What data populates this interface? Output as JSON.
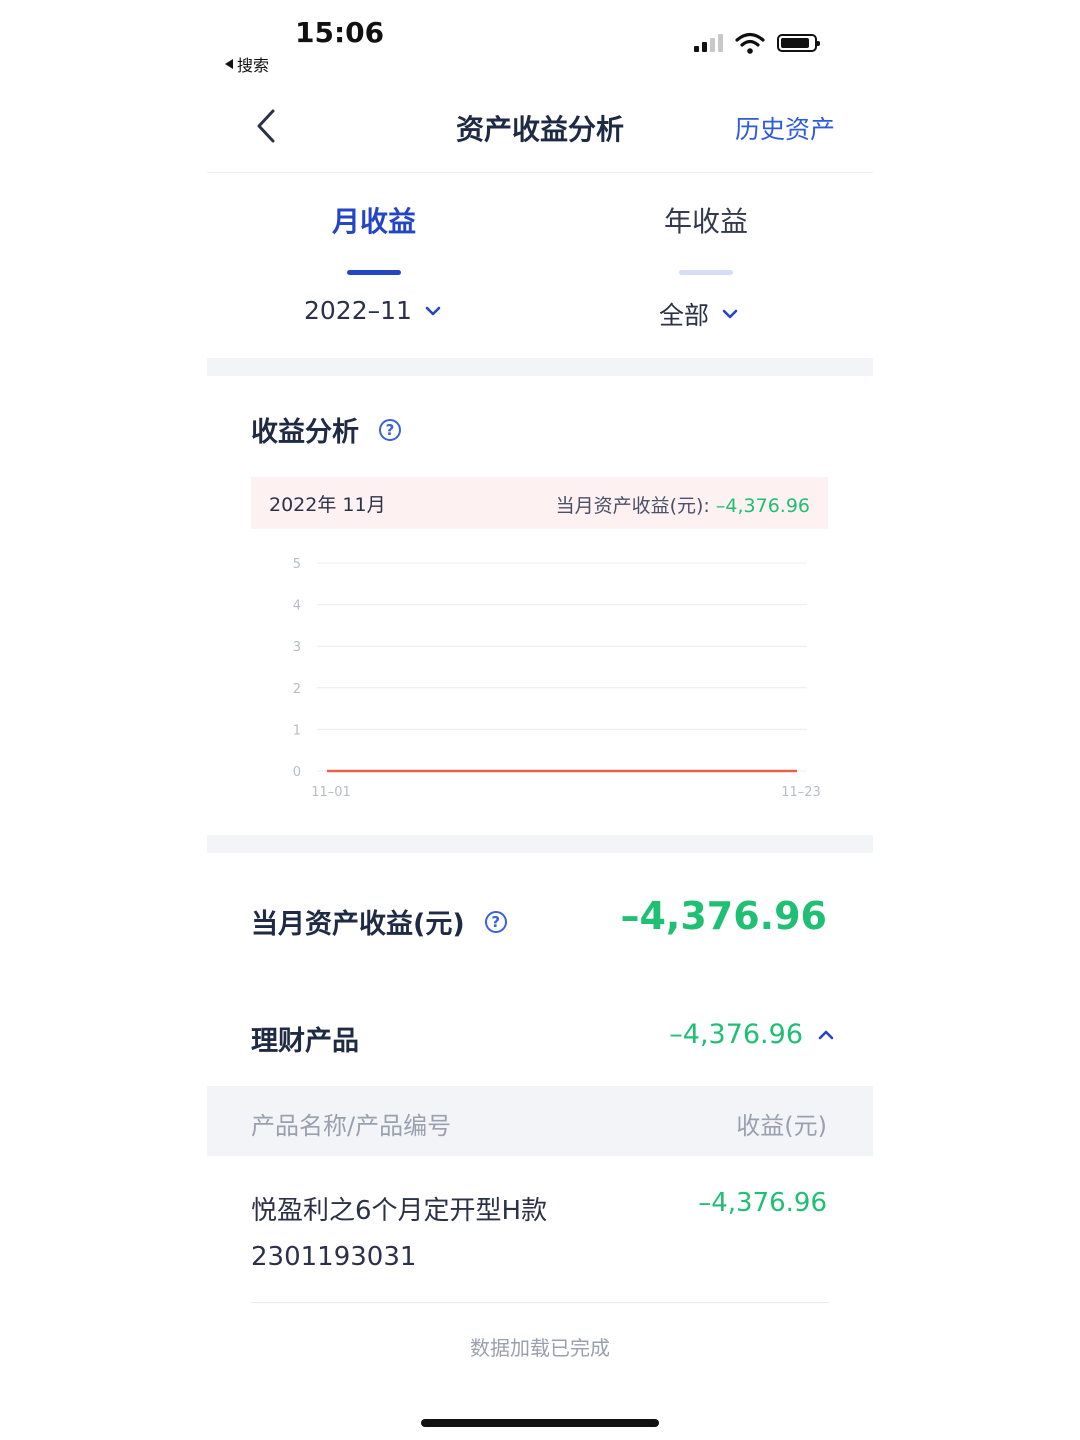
{
  "status_bar": {
    "time": "15:06",
    "back_app": "搜索"
  },
  "nav": {
    "title": "资产收益分析",
    "right_link": "历史资产"
  },
  "tabs": [
    {
      "label": "月收益",
      "active": true
    },
    {
      "label": "年收益",
      "active": false
    }
  ],
  "filters": {
    "date": "2022–11",
    "type": "全部"
  },
  "analysis": {
    "title": "收益分析",
    "period": "2022年 11月",
    "summary_label": "当月资产收益(元):",
    "summary_value": "–4,376.96"
  },
  "chart_data": {
    "type": "line",
    "x": [
      "11–01",
      "11–23"
    ],
    "series": [
      {
        "values": [
          0,
          0
        ]
      }
    ],
    "y_ticks": [
      "5",
      "4",
      "3",
      "2",
      "1",
      "0"
    ],
    "ylim": [
      0,
      5
    ],
    "grid": true,
    "colors": {
      "line": "#e8604c",
      "grid": "#ececf0",
      "tick": "#b8bcc8"
    }
  },
  "month_total": {
    "label": "当月资产收益(元)",
    "value": "–4,376.96"
  },
  "category": {
    "label": "理财产品",
    "value": "–4,376.96"
  },
  "table": {
    "headers": [
      "产品名称/产品编号",
      "收益(元)"
    ],
    "rows": [
      {
        "name": "悦盈利之6个月定开型H款",
        "code": "2301193031",
        "value": "–4,376.96"
      }
    ]
  },
  "footer": {
    "status": "数据加载已完成"
  },
  "colors": {
    "accent": "#2446c4",
    "link": "#2e5bdc",
    "negative": "#1fbf74",
    "band": "#f3f4f7"
  }
}
